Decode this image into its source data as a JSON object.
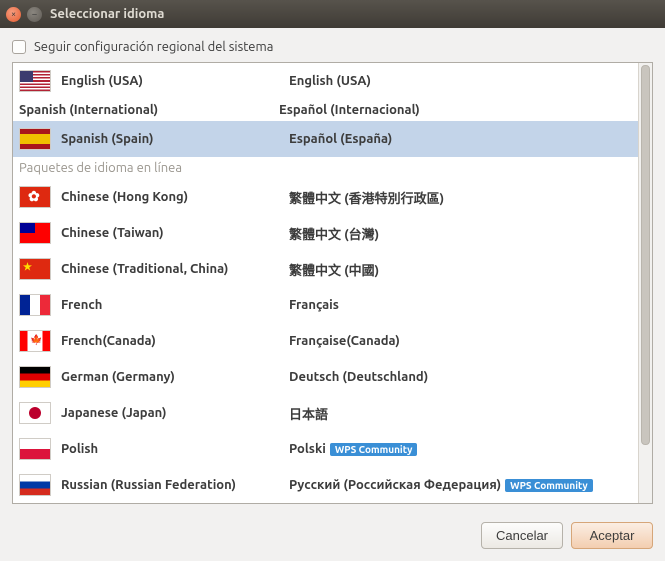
{
  "window": {
    "title": "Seleccionar idioma"
  },
  "checkbox": {
    "label": "Seguir configuración regional del sistema",
    "checked": false
  },
  "section_online": "Paquetes de idioma en línea",
  "badge_text": "WPS Community",
  "languages": [
    {
      "flag": "f-usa",
      "en": "English (USA)",
      "loc": "English (USA)",
      "selected": false
    },
    {
      "noflag": true,
      "en": "Spanish (International)",
      "loc": "Español (Internacional)",
      "selected": false,
      "mini": true
    },
    {
      "flag": "f-es",
      "en": "Spanish (Spain)",
      "loc": "Español (España)",
      "selected": true
    }
  ],
  "online_languages": [
    {
      "flag": "f-hk",
      "en": "Chinese (Hong Kong)",
      "loc": "繁體中文 (香港特別行政區)"
    },
    {
      "flag": "f-tw",
      "en": "Chinese (Taiwan)",
      "loc": "繁體中文 (台灣)"
    },
    {
      "flag": "f-cn",
      "en": "Chinese (Traditional, China)",
      "loc": "繁體中文 (中國)"
    },
    {
      "flag": "f-fr",
      "en": "French",
      "loc": "Français"
    },
    {
      "flag": "f-ca",
      "en": "French(Canada)",
      "loc": "Française(Canada)"
    },
    {
      "flag": "f-de",
      "en": "German (Germany)",
      "loc": "Deutsch (Deutschland)"
    },
    {
      "flag": "f-jp",
      "en": "Japanese (Japan)",
      "loc": "日本語"
    },
    {
      "flag": "f-pl",
      "en": "Polish",
      "loc": "Polski",
      "badge": true
    },
    {
      "flag": "f-ru",
      "en": "Russian (Russian Federation)",
      "loc": "Русский (Российская Федерация)",
      "badge": true
    }
  ],
  "buttons": {
    "cancel": "Cancelar",
    "accept": "Aceptar"
  }
}
